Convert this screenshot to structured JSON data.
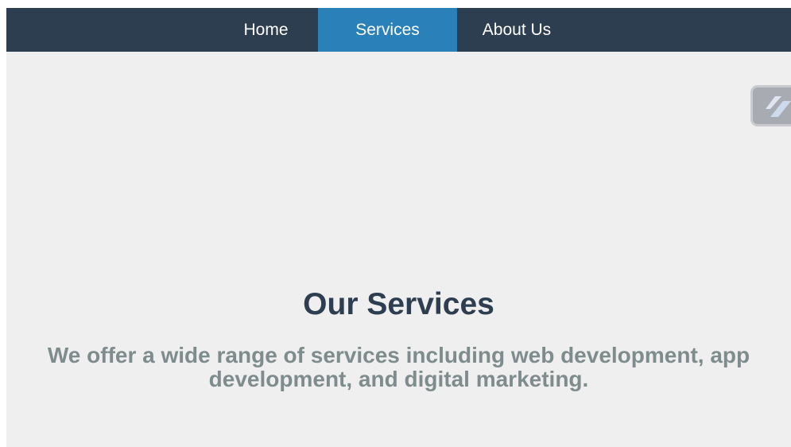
{
  "nav": {
    "items": [
      {
        "label": "Home",
        "active": false
      },
      {
        "label": "Services",
        "active": true
      },
      {
        "label": "About Us",
        "active": false
      }
    ]
  },
  "hero": {
    "title": "Our Services",
    "text": "We offer a wide range of services including web development, app development, and digital marketing."
  },
  "side_widget": {
    "icon": "link-stripes-icon"
  },
  "colors": {
    "navbar": "#2c3e50",
    "active_tab": "#2a80b9",
    "background": "#f0eff0",
    "title": "#2c3e50",
    "text": "#7f8c8d"
  }
}
